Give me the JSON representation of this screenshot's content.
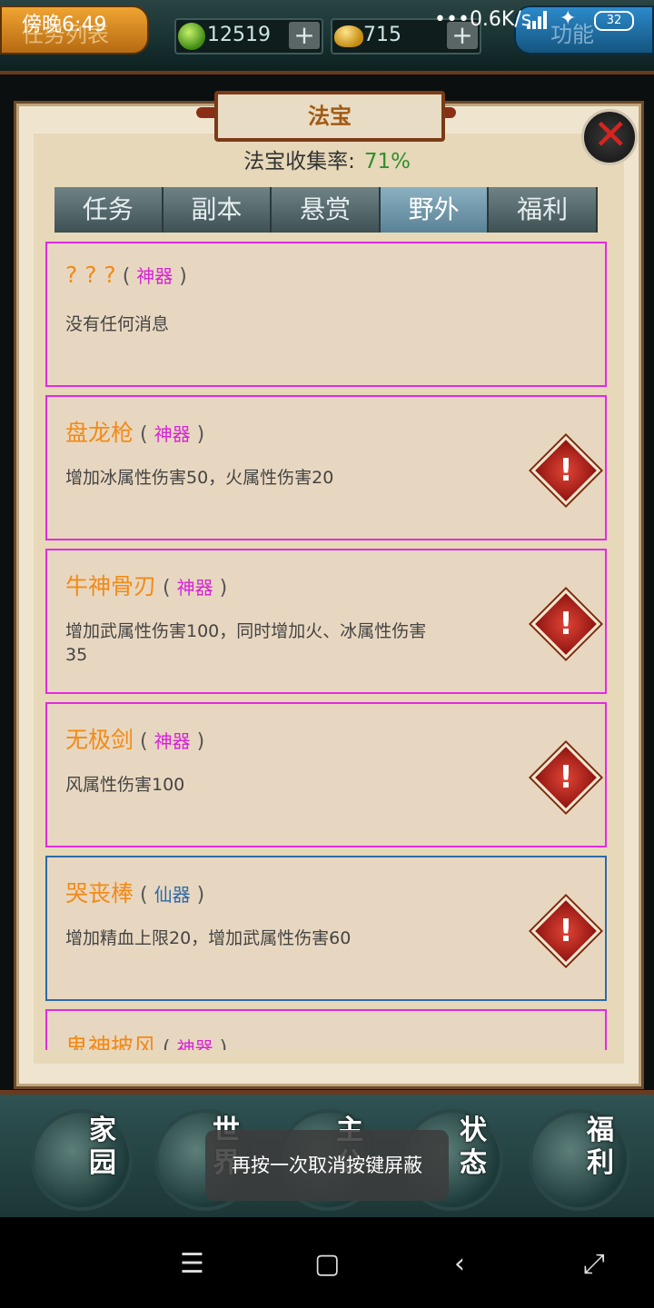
{
  "status_bar": {
    "time": "傍晚6:49",
    "network_speed": "0.6K/s",
    "battery": "32"
  },
  "top_bar": {
    "left_button": "任务列表",
    "right_button": "功能",
    "resources": [
      {
        "icon": "jade-coin-icon",
        "value": "12519",
        "add": "+"
      },
      {
        "icon": "gold-ingot-icon",
        "value": "715",
        "add": "+"
      }
    ]
  },
  "panel": {
    "title": "法宝",
    "collection_label": "法宝收集率:",
    "collection_rate": "71%",
    "close_icon": "close-x-icon",
    "tabs": [
      {
        "label": "任务",
        "active": false
      },
      {
        "label": "副本",
        "active": false
      },
      {
        "label": "悬赏",
        "active": false
      },
      {
        "label": "野外",
        "active": true
      },
      {
        "label": "福利",
        "active": false
      }
    ],
    "items": [
      {
        "name": "? ? ?",
        "rarity": "神器",
        "desc": "没有任何消息",
        "alert": false,
        "tier_color": "#e22be2"
      },
      {
        "name": "盘龙枪",
        "rarity": "神器",
        "desc": "增加冰属性伤害50，火属性伤害20",
        "alert": true,
        "tier_color": "#e22be2"
      },
      {
        "name": "牛神骨刃",
        "rarity": "神器",
        "desc": "增加武属性伤害100，同时增加火、冰属性伤害35",
        "alert": true,
        "tier_color": "#e22be2"
      },
      {
        "name": "无极剑",
        "rarity": "神器",
        "desc": "风属性伤害100",
        "alert": true,
        "tier_color": "#e22be2"
      },
      {
        "name": "哭丧棒",
        "rarity": "仙器",
        "desc": "增加精血上限20，增加武属性伤害60",
        "alert": true,
        "tier_color": "#2c6aa8"
      },
      {
        "name": "鬼神披风",
        "rarity": "神器",
        "desc": "",
        "alert": false,
        "tier_color": "#e22be2"
      }
    ]
  },
  "bottom_nav": [
    {
      "label": "家园",
      "icon": "home-icon"
    },
    {
      "label": "世界",
      "icon": "world-icon"
    },
    {
      "label": "主公",
      "icon": "lord-icon"
    },
    {
      "label": "状态",
      "icon": "status-icon"
    },
    {
      "label": "福利",
      "icon": "gift-bag-icon"
    }
  ],
  "toast": "再按一次取消按键屏蔽",
  "system_nav": [
    "menu",
    "home",
    "back",
    "screenshot"
  ]
}
